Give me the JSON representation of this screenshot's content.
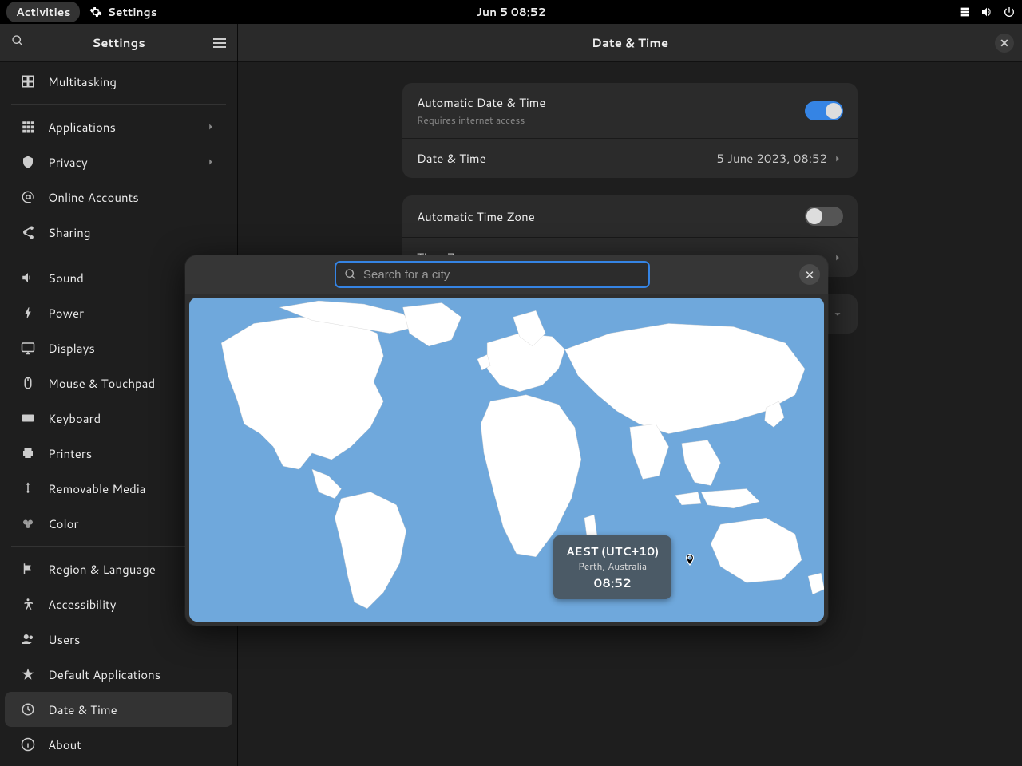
{
  "topbar": {
    "activities": "Activities",
    "app_name": "Settings",
    "clock": "Jun 5  08:52"
  },
  "sidebar": {
    "title": "Settings",
    "items": [
      {
        "label": "Multitasking",
        "icon": "multitask",
        "sep_after": true
      },
      {
        "label": "Applications",
        "icon": "apps",
        "chevron": true
      },
      {
        "label": "Privacy",
        "icon": "privacy",
        "chevron": true
      },
      {
        "label": "Online Accounts",
        "icon": "at"
      },
      {
        "label": "Sharing",
        "icon": "share",
        "sep_after": true
      },
      {
        "label": "Sound",
        "icon": "sound"
      },
      {
        "label": "Power",
        "icon": "power"
      },
      {
        "label": "Displays",
        "icon": "display"
      },
      {
        "label": "Mouse & Touchpad",
        "icon": "mouse"
      },
      {
        "label": "Keyboard",
        "icon": "keyboard"
      },
      {
        "label": "Printers",
        "icon": "printer"
      },
      {
        "label": "Removable Media",
        "icon": "usb"
      },
      {
        "label": "Color",
        "icon": "color",
        "sep_after": true
      },
      {
        "label": "Region & Language",
        "icon": "flag"
      },
      {
        "label": "Accessibility",
        "icon": "access"
      },
      {
        "label": "Users",
        "icon": "users"
      },
      {
        "label": "Default Applications",
        "icon": "star"
      },
      {
        "label": "Date & Time",
        "icon": "clock",
        "selected": true
      },
      {
        "label": "About",
        "icon": "info"
      }
    ]
  },
  "main": {
    "title": "Date & Time",
    "group1": {
      "auto_dt_label": "Automatic Date & Time",
      "auto_dt_sub": "Requires internet access",
      "auto_dt_on": true,
      "dt_label": "Date & Time",
      "dt_value": "5 June 2023, 08:52"
    },
    "group2": {
      "auto_tz_label": "Automatic Time Zone",
      "auto_tz_on": false,
      "tz_label": "Time Zone"
    }
  },
  "popover": {
    "search_placeholder": "Search for a city",
    "tz_name": "AEST (UTC+10)",
    "tz_loc": "Perth, Australia",
    "tz_time": "08:52"
  }
}
